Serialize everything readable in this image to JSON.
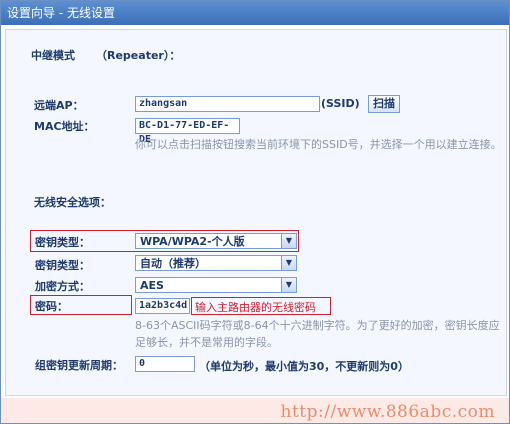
{
  "window": {
    "title": "设置向导 - 无线设置"
  },
  "mode": {
    "label": "中继模式",
    "value": "（Repeater）："
  },
  "remote_ap": {
    "label": "远端AP：",
    "value": "zhangsan",
    "suffix": "(SSID)",
    "scan_button": "扫描"
  },
  "mac": {
    "label": "MAC地址：",
    "value": "BC-D1-77-ED-EF-DE"
  },
  "scan_hint": "你可以点击扫描按钮搜索当前环境下的SSID号，并选择一个用以建立连接。",
  "security": {
    "section_label": "无线安全选项：",
    "key_type1": {
      "label": "密钥类型：",
      "value": "WPA/WPA2-个人版"
    },
    "key_type2": {
      "label": "密钥类型：",
      "value": "自动（推荐）"
    },
    "encryption": {
      "label": "加密方式：",
      "value": "AES"
    },
    "password": {
      "label": "密码：",
      "value": "1a2b3c4d",
      "annotation": "输入主路由器的无线密码"
    },
    "password_hint": "8-63个ASCII码字符或8-64个十六进制字符。为了更好的加密，密钥长度应足够长，并不是常用的字段。",
    "group_key": {
      "label": "组密钥更新周期：",
      "value": "0",
      "suffix": "（单位为秒，最小值为30，不更新则为0）"
    }
  },
  "watermark": "http://www.886abc.com",
  "colors": {
    "title_bar": "#4a7cc4",
    "annotation_red": "#d0202a",
    "text": "#1f3b6e"
  }
}
